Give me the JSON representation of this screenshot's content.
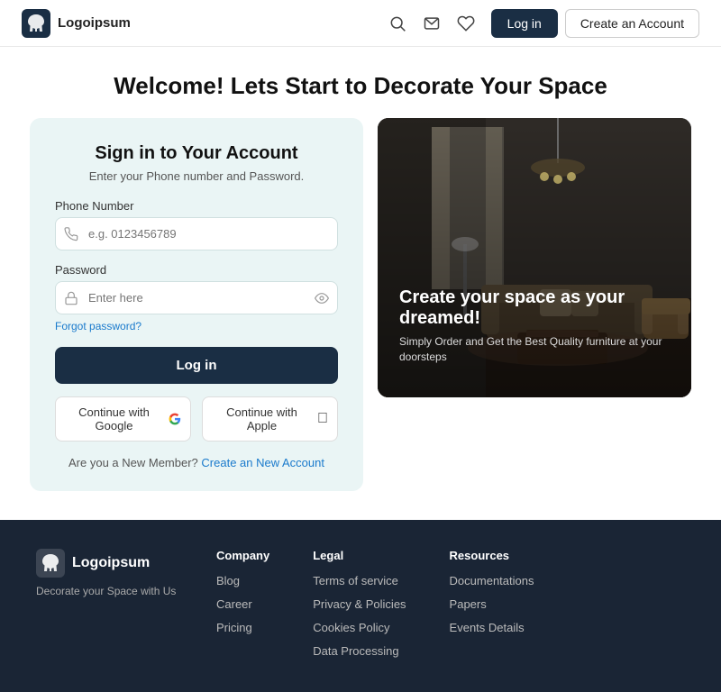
{
  "navbar": {
    "logo_text": "Logoipsum",
    "login_label": "Log in",
    "create_account_label": "Create an Account"
  },
  "hero": {
    "title": "Welcome! Lets Start to Decorate Your Space"
  },
  "login_card": {
    "heading": "Sign in to Your Account",
    "subtitle": "Enter your Phone number and Password.",
    "phone_label": "Phone Number",
    "phone_placeholder": "e.g. 0123456789",
    "password_label": "Password",
    "password_placeholder": "Enter here",
    "forgot_label": "Forgot password?",
    "login_button": "Log in",
    "google_button": "Continue with Google",
    "apple_button": "Continue with Apple",
    "new_member_text": "Are you a New Member?",
    "create_link": "Create an New Account"
  },
  "room_promo": {
    "heading": "Create your space as your dreamed!",
    "subtext": "Simply Order and Get the Best Quality furniture at your doorsteps"
  },
  "footer": {
    "logo_text": "Logoipsum",
    "tagline": "Decorate your Space with Us",
    "company": {
      "heading": "Company",
      "items": [
        "Blog",
        "Career",
        "Pricing"
      ]
    },
    "legal": {
      "heading": "Legal",
      "items": [
        "Terms of service",
        "Privacy & Policies",
        "Cookies Policy",
        "Data Processing"
      ]
    },
    "resources": {
      "heading": "Resources",
      "items": [
        "Documentations",
        "Papers",
        "Events Details"
      ]
    }
  }
}
